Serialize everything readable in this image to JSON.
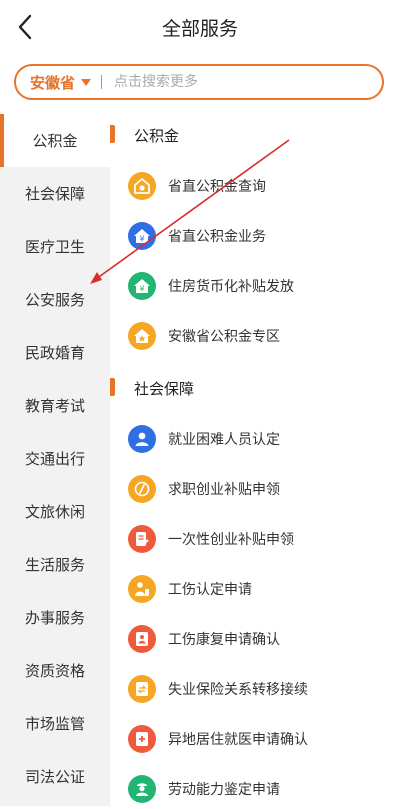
{
  "header": {
    "title": "全部服务"
  },
  "search": {
    "province": "安徽省",
    "placeholder": "点击搜索更多"
  },
  "sidebar": {
    "items": [
      {
        "label": "公积金",
        "active": true
      },
      {
        "label": "社会保障"
      },
      {
        "label": "医疗卫生"
      },
      {
        "label": "公安服务"
      },
      {
        "label": "民政婚育"
      },
      {
        "label": "教育考试"
      },
      {
        "label": "交通出行"
      },
      {
        "label": "文旅休闲"
      },
      {
        "label": "生活服务"
      },
      {
        "label": "办事服务"
      },
      {
        "label": "资质资格"
      },
      {
        "label": "市场监管"
      },
      {
        "label": "司法公证"
      }
    ]
  },
  "sections": [
    {
      "title": "公积金",
      "items": [
        {
          "label": "省直公积金查询",
          "icon": "house-coin-icon",
          "color": "#f5a623"
        },
        {
          "label": "省直公积金业务",
          "icon": "house-yen-icon",
          "color": "#2f6fe4"
        },
        {
          "label": "住房货币化补贴发放",
          "icon": "house-yen-icon",
          "color": "#22b573"
        },
        {
          "label": "安徽省公积金专区",
          "icon": "house-star-icon",
          "color": "#f5a623"
        }
      ]
    },
    {
      "title": "社会保障",
      "items": [
        {
          "label": "就业困难人员认定",
          "icon": "person-icon",
          "color": "#2f6fe4"
        },
        {
          "label": "求职创业补贴申领",
          "icon": "pen-icon",
          "color": "#f5a623"
        },
        {
          "label": "一次性创业补贴申领",
          "icon": "document-edit-icon",
          "color": "#ef5a3c"
        },
        {
          "label": "工伤认定申请",
          "icon": "injured-person-icon",
          "color": "#f5a623"
        },
        {
          "label": "工伤康复申请确认",
          "icon": "document-person-icon",
          "color": "#ef5a3c"
        },
        {
          "label": "失业保险关系转移接续",
          "icon": "transfer-doc-icon",
          "color": "#f5a623"
        },
        {
          "label": "异地居住就医申请确认",
          "icon": "medical-doc-icon",
          "color": "#ef5a3c"
        },
        {
          "label": "劳动能力鉴定申请",
          "icon": "worker-icon",
          "color": "#22b573"
        }
      ]
    }
  ],
  "theme": {
    "accent": "#e8742a",
    "annotation_arrow": "#d92b2b"
  }
}
